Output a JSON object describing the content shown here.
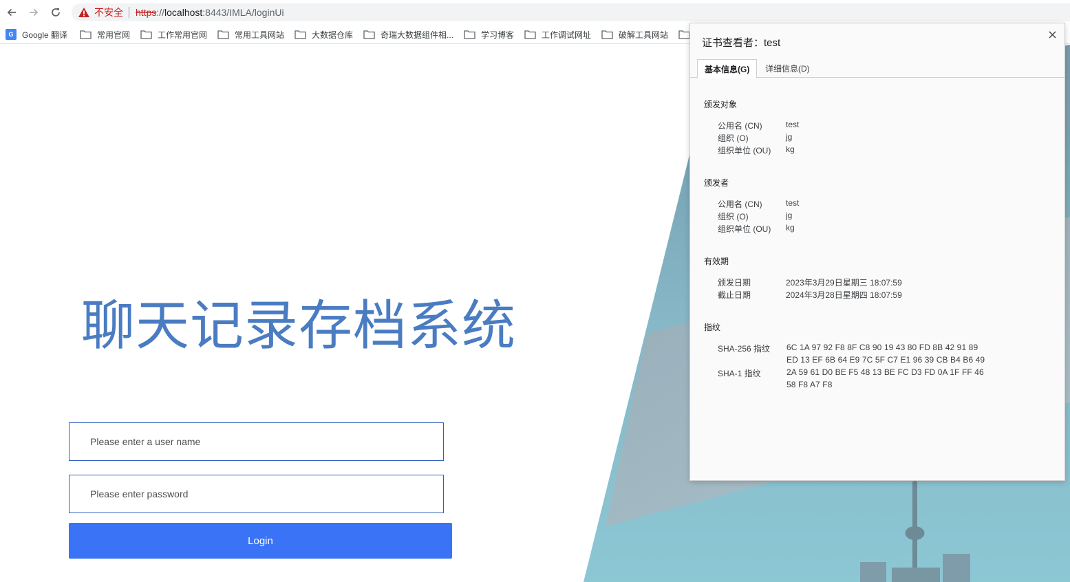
{
  "browser": {
    "not_secure": "不安全",
    "url_scheme": "https",
    "url_sep": "://",
    "url_host": "localhost",
    "url_rest": ":8443/IMLA/loginUi"
  },
  "bookmarks": [
    "Google 翻译",
    "常用官网",
    "工作常用官网",
    "常用工具网站",
    "大数据仓库",
    "奇瑞大数据组件相...",
    "学习博客",
    "工作调试网址",
    "破解工具网站"
  ],
  "page": {
    "title": "聊天记录存档系统",
    "username_placeholder": "Please enter a user name",
    "password_placeholder": "Please enter password",
    "login_label": "Login"
  },
  "cert": {
    "title": "证书查看者：test",
    "tabs": [
      "基本信息(G)",
      "详细信息(D)"
    ],
    "subject": {
      "heading": "颁发对象",
      "rows": [
        {
          "key": "公用名 (CN)",
          "value": "test"
        },
        {
          "key": "组织 (O)",
          "value": "jg"
        },
        {
          "key": "组织单位 (OU)",
          "value": "kg"
        }
      ]
    },
    "issuer": {
      "heading": "颁发者",
      "rows": [
        {
          "key": "公用名 (CN)",
          "value": "test"
        },
        {
          "key": "组织 (O)",
          "value": "jg"
        },
        {
          "key": "组织单位 (OU)",
          "value": "kg"
        }
      ]
    },
    "validity": {
      "heading": "有效期",
      "rows": [
        {
          "key": "颁发日期",
          "value": "2023年3月29日星期三 18:07:59"
        },
        {
          "key": "截止日期",
          "value": "2024年3月28日星期四 18:07:59"
        }
      ]
    },
    "fingerprints": {
      "heading": "指纹",
      "sha256_key": "SHA-256 指纹",
      "sha256_line1": "6C 1A 97 92 F8 8F C8 90 19 43 80 FD 8B 42 91 89",
      "sha256_line2": "ED 13 EF 6B 64 E9 7C 5F C7 E1 96 39 CB B4 B6 49",
      "sha1_key": "SHA-1 指纹",
      "sha1_line1": "2A 59 61 D0 BE F5 48 13 BE FC D3 FD 0A 1F FF 46",
      "sha1_line2": "58 F8 A7 F8"
    }
  },
  "colors": {
    "title_blue": "#4a7cc2",
    "login_blue": "#3a73f6",
    "warning_red": "#c5221f",
    "field_border": "#2f5dbd"
  },
  "icons": [
    "back-arrow-icon",
    "forward-arrow-icon",
    "reload-icon",
    "warning-triangle-icon",
    "google-translate-icon",
    "folder-icon",
    "close-icon"
  ]
}
